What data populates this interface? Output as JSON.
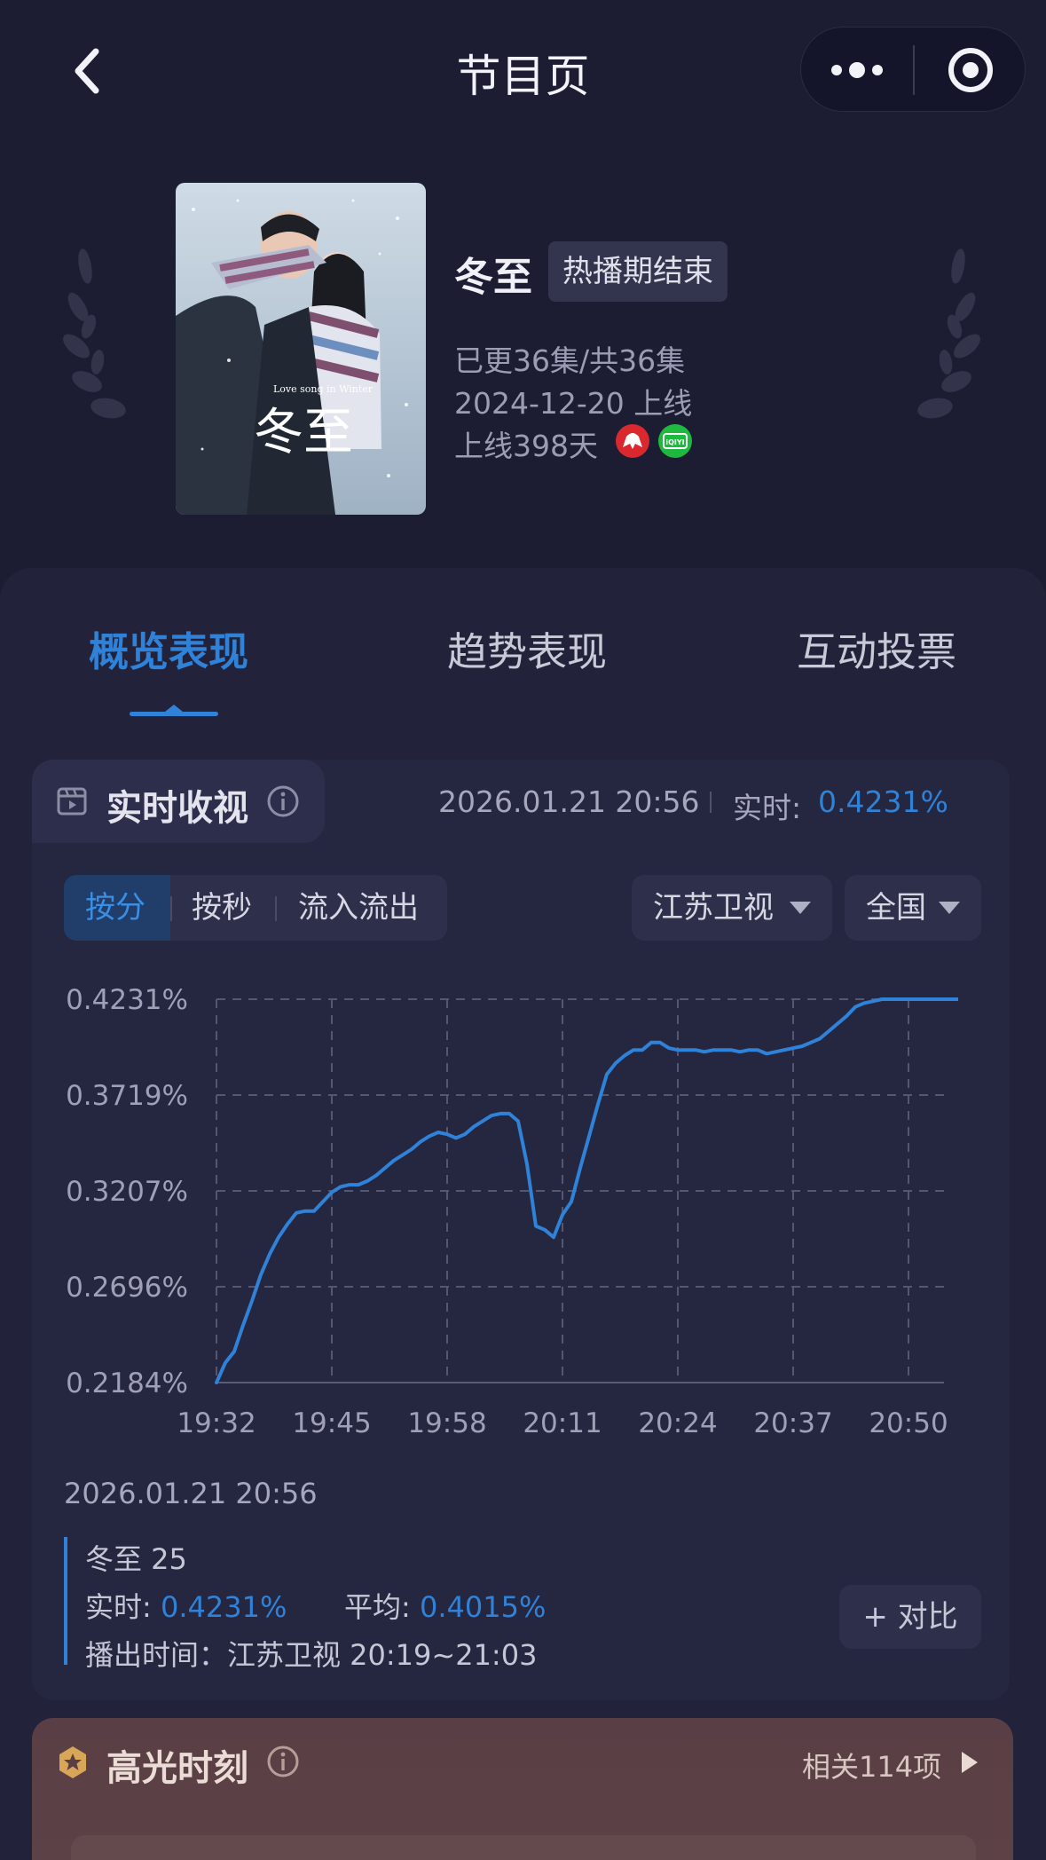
{
  "nav": {
    "title": "节目页"
  },
  "show": {
    "name": "冬至",
    "status": "热播期结束",
    "episodes": "已更36集/共36集",
    "release": "2024-12-20 上线",
    "days_online": "上线398天",
    "poster_title_en": "Love song in Winter",
    "poster_title_cn": "冬至",
    "platforms": [
      {
        "name": "jiangsu-tv-icon",
        "color": "#d9292f"
      },
      {
        "name": "iqiyi-icon",
        "color": "#1fb940",
        "text": "iQIYI"
      }
    ]
  },
  "tabs": [
    {
      "label": "概览表现",
      "active": true
    },
    {
      "label": "趋势表现",
      "active": false
    },
    {
      "label": "互动投票",
      "active": false
    }
  ],
  "realtime": {
    "title": "实时收视",
    "timestamp": "2026.01.21 20:56",
    "label": "实时:",
    "value": "0.4231%"
  },
  "segments": [
    {
      "label": "按分",
      "active": true
    },
    {
      "label": "按秒",
      "active": false
    },
    {
      "label": "流入流出",
      "active": false
    }
  ],
  "filters": {
    "channel": "江苏卫视",
    "region": "全国"
  },
  "chart_data": {
    "type": "line",
    "title": "",
    "xlabel": "",
    "ylabel": "",
    "unit": "%",
    "x_ticks": [
      "19:32",
      "19:45",
      "19:58",
      "20:11",
      "20:24",
      "20:37",
      "20:50"
    ],
    "y_ticks": [
      "0.2184%",
      "0.2696%",
      "0.3207%",
      "0.3719%",
      "0.4231%"
    ],
    "ylim": [
      0.2184,
      0.4231
    ],
    "grid": true,
    "color": "#2f82d8",
    "series": [
      {
        "x": [
          "19:32",
          "19:33",
          "19:34",
          "19:35",
          "19:36",
          "19:37",
          "19:38",
          "19:39",
          "19:40",
          "19:41",
          "19:42",
          "19:43",
          "19:44",
          "19:45",
          "19:46",
          "19:47",
          "19:48",
          "19:49",
          "19:50",
          "19:51",
          "19:52",
          "19:53",
          "19:54",
          "19:55",
          "19:56",
          "19:57",
          "19:58",
          "19:59",
          "20:00",
          "20:01",
          "20:02",
          "20:03",
          "20:04",
          "20:05",
          "20:06",
          "20:07",
          "20:08",
          "20:09",
          "20:10",
          "20:11",
          "20:12",
          "20:13",
          "20:14",
          "20:15",
          "20:16",
          "20:17",
          "20:18",
          "20:19",
          "20:20",
          "20:21",
          "20:22",
          "20:23",
          "20:24",
          "20:25",
          "20:26",
          "20:27",
          "20:28",
          "20:29",
          "20:30",
          "20:31",
          "20:32",
          "20:33",
          "20:34",
          "20:35",
          "20:36",
          "20:37",
          "20:38",
          "20:39",
          "20:40",
          "20:41",
          "20:42",
          "20:43",
          "20:44",
          "20:45",
          "20:46",
          "20:47",
          "20:48",
          "20:49",
          "20:50",
          "20:51",
          "20:52",
          "20:53",
          "20:54",
          "20:55",
          "20:56"
        ],
        "values": [
          0.2184,
          0.229,
          0.235,
          0.249,
          0.262,
          0.276,
          0.287,
          0.296,
          0.303,
          0.309,
          0.31,
          0.31,
          0.315,
          0.32,
          0.323,
          0.324,
          0.324,
          0.326,
          0.329,
          0.333,
          0.337,
          0.34,
          0.343,
          0.347,
          0.35,
          0.352,
          0.351,
          0.349,
          0.351,
          0.355,
          0.358,
          0.361,
          0.362,
          0.362,
          0.358,
          0.335,
          0.302,
          0.3,
          0.296,
          0.308,
          0.315,
          0.333,
          0.35,
          0.367,
          0.383,
          0.389,
          0.393,
          0.396,
          0.396,
          0.4,
          0.4,
          0.397,
          0.396,
          0.396,
          0.396,
          0.395,
          0.396,
          0.396,
          0.396,
          0.395,
          0.396,
          0.396,
          0.394,
          0.395,
          0.396,
          0.397,
          0.398,
          0.4,
          0.402,
          0.406,
          0.41,
          0.414,
          0.419,
          0.421,
          0.422,
          0.4231,
          0.4231,
          0.4231,
          0.4231,
          0.4231,
          0.4231,
          0.4231,
          0.4231,
          0.4231,
          0.4231
        ]
      }
    ]
  },
  "tooltip": {
    "time": "2026.01.21 20:56",
    "episode": "冬至 25",
    "realtime_label": "实时:",
    "realtime_value": "0.4231%",
    "avg_label": "平均:",
    "avg_value": "0.4015%",
    "airtime": "播出时间：江苏卫视 20:19~21:03"
  },
  "compare_label": "+ 对比",
  "highlights": {
    "title": "高光时刻",
    "related": "相关114项"
  }
}
